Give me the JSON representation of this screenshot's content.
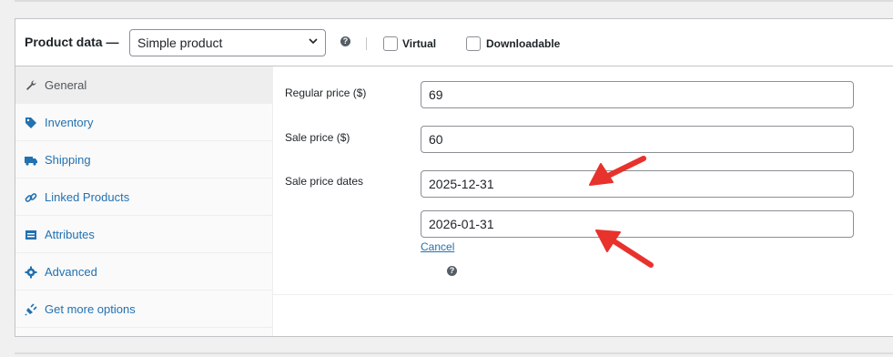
{
  "header": {
    "title": "Product data —",
    "product_type": "Simple product",
    "virtual_label": "Virtual",
    "downloadable_label": "Downloadable"
  },
  "tabs": [
    {
      "label": "General",
      "icon": "wrench-icon",
      "active": true
    },
    {
      "label": "Inventory",
      "icon": "tag-icon"
    },
    {
      "label": "Shipping",
      "icon": "truck-icon"
    },
    {
      "label": "Linked Products",
      "icon": "link-icon"
    },
    {
      "label": "Attributes",
      "icon": "list-icon"
    },
    {
      "label": "Advanced",
      "icon": "gear-icon"
    },
    {
      "label": "Get more options",
      "icon": "plugin-icon"
    }
  ],
  "general": {
    "regular_price_label": "Regular price ($)",
    "regular_price": "69",
    "sale_price_label": "Sale price ($)",
    "sale_price": "60",
    "sale_dates_label": "Sale price dates",
    "date_from": "2025-12-31",
    "date_to": "2026-01-31",
    "cancel_label": "Cancel"
  },
  "colors": {
    "link": "#2271b1",
    "arrow": "#e8322c"
  }
}
